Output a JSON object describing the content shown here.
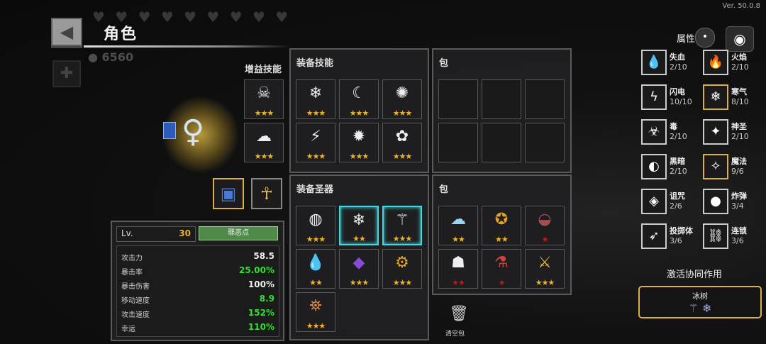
{
  "version": "Ver. 50.0.8",
  "header": {
    "back_icon": "◀",
    "title": "角色",
    "coins": "6560",
    "plus": "✚"
  },
  "skills": {
    "boost_label": "增益技能",
    "boost": [
      {
        "icon": "☠",
        "stars": "★★★"
      },
      {
        "icon": "☁",
        "stars": "★★★"
      }
    ],
    "equipped_title": "装备技能",
    "equipped": [
      {
        "icon": "❄",
        "stars": "★★★"
      },
      {
        "icon": "☾",
        "stars": "★★★"
      },
      {
        "icon": "✺",
        "stars": "★★★"
      },
      {
        "icon": "⚡",
        "stars": "★★★"
      },
      {
        "icon": "✹",
        "stars": "★★★"
      },
      {
        "icon": "✿",
        "stars": "★★★"
      }
    ],
    "bag_title": "包"
  },
  "relics": {
    "equipped_title": "装备圣器",
    "equipped": [
      {
        "icon": "◍",
        "stars": "★★★"
      },
      {
        "icon": "❄",
        "stars": "★★"
      },
      {
        "icon": "⚚",
        "stars": "★★★"
      },
      {
        "icon": "💧",
        "stars": "★★"
      },
      {
        "icon": "◆",
        "stars": "★★★"
      },
      {
        "icon": "⚙",
        "stars": "★★★"
      },
      {
        "icon": "⛯",
        "stars": "★★★"
      }
    ],
    "bag_title": "包",
    "bag": [
      {
        "icon": "☁",
        "stars": "★★",
        "red": false
      },
      {
        "icon": "✪",
        "stars": "★★",
        "red": false
      },
      {
        "icon": "◒",
        "stars": "★",
        "red": true
      },
      {
        "icon": "☗",
        "stars": "★★",
        "red": true
      },
      {
        "icon": "⚗",
        "stars": "★",
        "red": true
      },
      {
        "icon": "⚔",
        "stars": "★★★",
        "red": false
      }
    ],
    "clear_label": "清空包"
  },
  "character": {
    "book_icon": "▯",
    "sprite": "♀",
    "equip1": "▣",
    "equip2": "☥"
  },
  "stats": {
    "lv_label": "Lv.",
    "lv": "30",
    "sin_button": "罪恶点",
    "rows": [
      {
        "label": "攻击力",
        "value": "58.5",
        "green": false
      },
      {
        "label": "暴击率",
        "value": "25.00%",
        "green": true
      },
      {
        "label": "暴击伤害",
        "value": "100%",
        "green": false
      },
      {
        "label": "移动速度",
        "value": "8.9",
        "green": true
      },
      {
        "label": "攻击速度",
        "value": "152%",
        "green": true
      },
      {
        "label": "幸运",
        "value": "110%",
        "green": true
      }
    ]
  },
  "synergy": {
    "header": "属性协同",
    "toggle_icon": "•",
    "target_icon": "◉",
    "items": [
      {
        "name": "失血",
        "value": "2/10",
        "icon": "💧",
        "on": false
      },
      {
        "name": "火焰",
        "value": "2/10",
        "icon": "🔥",
        "on": false
      },
      {
        "name": "闪电",
        "value": "10/10",
        "icon": "ϟ",
        "on": false
      },
      {
        "name": "寒气",
        "value": "8/10",
        "icon": "❄",
        "on": true
      },
      {
        "name": "毒",
        "value": "2/10",
        "icon": "☣",
        "on": false
      },
      {
        "name": "神圣",
        "value": "2/10",
        "icon": "✦",
        "on": false
      },
      {
        "name": "黑暗",
        "value": "2/10",
        "icon": "◐",
        "on": false
      },
      {
        "name": "魔法",
        "value": "9/6",
        "icon": "✧",
        "on": true
      },
      {
        "name": "诅咒",
        "value": "2/6",
        "icon": "◈",
        "on": false
      },
      {
        "name": "炸弹",
        "value": "3/4",
        "icon": "●",
        "on": false
      },
      {
        "name": "投掷体",
        "value": "3/6",
        "icon": "➶",
        "on": false
      },
      {
        "name": "连锁",
        "value": "3/6",
        "icon": "⛓",
        "on": false
      }
    ],
    "activate_label": "激活协同作用",
    "active": {
      "name": "冰树",
      "icons": "⚚ ❄"
    }
  }
}
